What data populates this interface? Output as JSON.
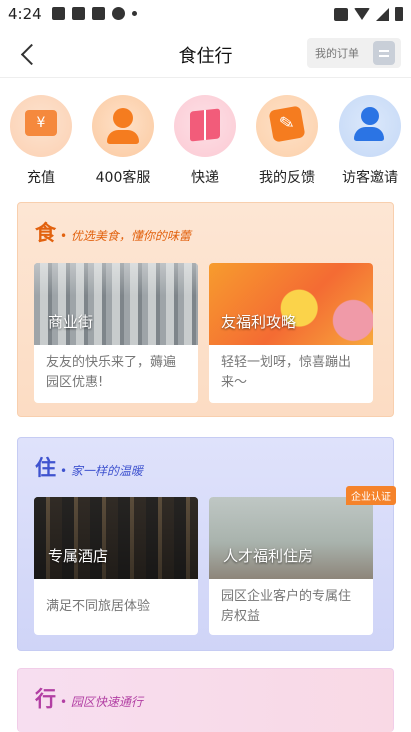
{
  "status_bar": {
    "time": "4:24"
  },
  "nav": {
    "title": "食住行",
    "orders_label": "我的订单"
  },
  "quick_actions": [
    {
      "label": "充值",
      "icon": "recharge-icon"
    },
    {
      "label": "400客服",
      "icon": "customer-service-icon"
    },
    {
      "label": "快递",
      "icon": "express-icon"
    },
    {
      "label": "我的反馈",
      "icon": "feedback-icon"
    },
    {
      "label": "访客邀请",
      "icon": "visitor-invite-icon"
    }
  ],
  "sections": {
    "food": {
      "char": "食",
      "subtitle": "• 优选美食，懂你的味蕾",
      "cards": [
        {
          "title": "商业街",
          "desc": "友友的快乐来了，薅遍园区优惠!"
        },
        {
          "title": "友福利攻略",
          "desc": "轻轻一划呀，惊喜蹦出来～"
        }
      ]
    },
    "stay": {
      "char": "住",
      "subtitle": "• 家一样的温暖",
      "badge": "企业认证",
      "cards": [
        {
          "title": "专属酒店",
          "desc": "满足不同旅居体验"
        },
        {
          "title": "人才福利住房",
          "desc": "园区企业客户的专属住房权益"
        }
      ]
    },
    "go": {
      "char": "行",
      "subtitle": "• 园区快速通行"
    }
  },
  "colors": {
    "food_accent": "#e2620f",
    "stay_accent": "#3f53cf",
    "go_accent": "#b23fa3",
    "badge": "#f5832b"
  }
}
